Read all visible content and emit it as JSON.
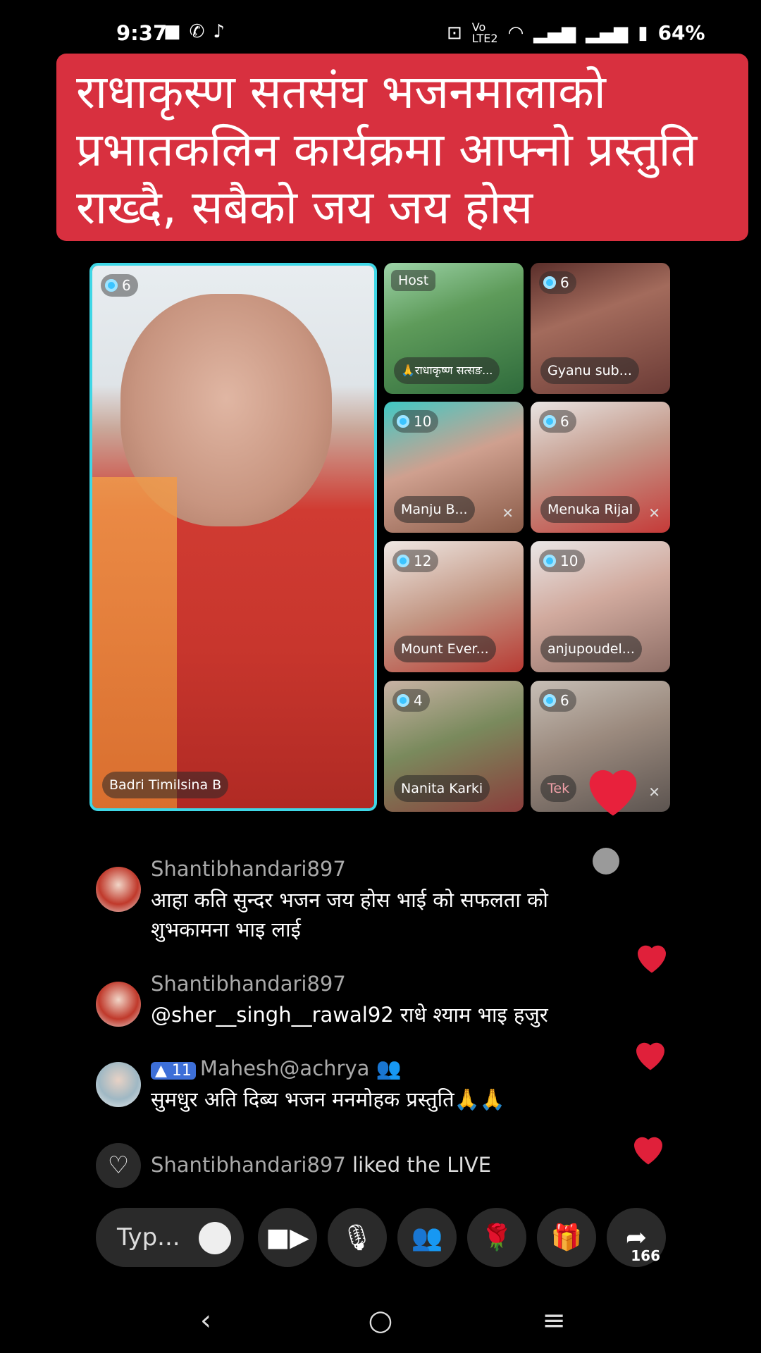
{
  "status_bar": {
    "time": "9:37",
    "battery": "64%",
    "left_icons": [
      "camera-icon",
      "phone-icon",
      "tiktok-icon"
    ],
    "right_icons": [
      "cast-icon",
      "volte-icon",
      "wifi-icon",
      "signal-icon",
      "signal-icon",
      "battery-icon"
    ]
  },
  "banner": {
    "text": "राधाकृस्ण सतसंघ भजनमालाको\nप्रभातकलिन कार्यक्रमा आफ्नो प्रस्तुति\nराख्दै,  सबैको जय जय  होस",
    "color": "#d8303f"
  },
  "live": {
    "main_tile": {
      "name": "Badri Timilsina B",
      "count": "6"
    },
    "tiles": [
      {
        "name": "🙏राधाकृष्ण सत्सङ...",
        "badge": "Host"
      },
      {
        "name": "Gyanu sub...",
        "count": "6"
      },
      {
        "name": "Manju B...",
        "count": "10"
      },
      {
        "name": "Menuka Rijal",
        "count": "6"
      },
      {
        "name": "Mount Ever...",
        "count": "12"
      },
      {
        "name": "anjupoudel...",
        "count": "10"
      },
      {
        "name": "Nanita Karki",
        "count": "4"
      },
      {
        "name": "Tek",
        "count": "6"
      }
    ]
  },
  "comments": [
    {
      "user": "Shantibhandari897",
      "text": "आहा कति सुन्दर भजन जय होस भाई को सफलता को शुभकामना भाइ लाई"
    },
    {
      "user": "Shantibhandari897",
      "text": "@sher__singh__rawal92 राधे श्याम भाइ हजुर"
    },
    {
      "user": "Mahesh@achrya",
      "level": "11",
      "text": "सुमधुर अति दिब्य भजन  मनमोहक प्रस्तुति🙏🙏"
    }
  ],
  "like_notice": {
    "user": "Shantibhandari897",
    "action": "liked the LIVE"
  },
  "bottom_bar": {
    "input_placeholder": "Typ...",
    "share_count": "166",
    "icons": [
      "emoji-icon",
      "video-camera-icon",
      "mic-off-icon",
      "guests-icon",
      "rose-gift-icon",
      "gift-icon",
      "share-icon"
    ]
  },
  "nav": {
    "icons": [
      "back-icon",
      "home-icon",
      "recents-icon"
    ]
  }
}
